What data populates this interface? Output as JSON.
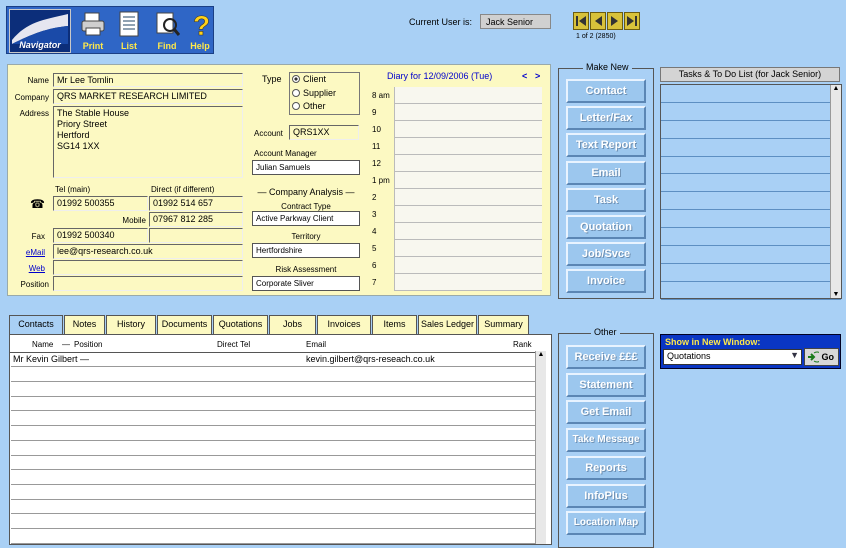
{
  "toolbar": {
    "navigator_label": "Navigator",
    "print_label": "Print",
    "list_label": "List",
    "find_label": "Find",
    "help_label": "Help"
  },
  "header": {
    "current_user_label": "Current User is:",
    "current_user": "Jack Senior",
    "record_count": "1 of 2 (2850)"
  },
  "contact": {
    "name_label": "Name",
    "name": "Mr Lee Tomlin",
    "company_label": "Company",
    "company": "QRS MARKET RESEARCH LIMITED",
    "address_label": "Address",
    "address": "The Stable House\nPriory Street\nHertford\nSG14 1XX",
    "tel_main_label": "Tel (main)",
    "direct_label": "Direct (if different)",
    "tel_main": "01992 500355",
    "tel_direct": "01992 514 657",
    "mobile_label": "Mobile",
    "mobile": "07967 812 285",
    "fax_label": "Fax",
    "fax": "01992 500340",
    "email_label": "eMail",
    "email": "lee@qrs-research.co.uk",
    "web_label": "Web",
    "web": "",
    "position_label": "Position",
    "position": ""
  },
  "classification": {
    "type_label": "Type",
    "type_options": [
      "Client",
      "Supplier",
      "Other"
    ],
    "type_selected": "Client",
    "account_label": "Account",
    "account": "QRS1XX",
    "account_manager_label": "Account Manager",
    "account_manager": "Julian Samuels",
    "company_analysis_label": "Company Analysis",
    "contract_type_label": "Contract Type",
    "contract_type": "Active Parkway Client",
    "territory_label": "Territory",
    "territory": "Hertfordshire",
    "risk_label": "Risk Assessment",
    "risk": "Corporate Sliver"
  },
  "diary": {
    "title": "Diary for 12/09/2006 (Tue)",
    "prev": "<",
    "next": ">",
    "hours": [
      "8 am",
      "9",
      "10",
      "11",
      "12",
      "1 pm",
      "2",
      "3",
      "4",
      "5",
      "6",
      "7"
    ]
  },
  "make_new": {
    "title": "Make New",
    "buttons": [
      "Contact",
      "Letter/Fax",
      "Text Report",
      "Email",
      "Task",
      "Quotation",
      "Job/Svce",
      "Invoice"
    ]
  },
  "tasks": {
    "title": "Tasks & To Do List (for Jack Senior)"
  },
  "tabs": [
    "Contacts",
    "Notes",
    "History",
    "Documents",
    "Quotations",
    "Jobs",
    "Invoices",
    "Items",
    "Sales Ledger",
    "Summary"
  ],
  "active_tab": "Contacts",
  "contacts_grid": {
    "col_name": "Name",
    "col_position": "Position",
    "col_direct": "Direct Tel",
    "col_email": "Email",
    "col_rank": "Rank",
    "rows": [
      {
        "name": "Mr Kevin Gilbert",
        "position": "",
        "direct": "",
        "email": "kevin.gilbert@qrs-reseach.co.uk",
        "rank": ""
      }
    ]
  },
  "other": {
    "title": "Other",
    "buttons": [
      "Receive £££",
      "Statement",
      "Get Email",
      "Take Message",
      "Reports",
      "InfoPlus",
      "Location Map"
    ]
  },
  "show_window": {
    "label": "Show in New Window:",
    "selected": "Quotations",
    "go_label": "Go"
  },
  "colors": {
    "background": "#a9d0f5",
    "panel": "#fcf9c2",
    "toolbar": "#2f66c6",
    "button": "#9cc7ee"
  }
}
